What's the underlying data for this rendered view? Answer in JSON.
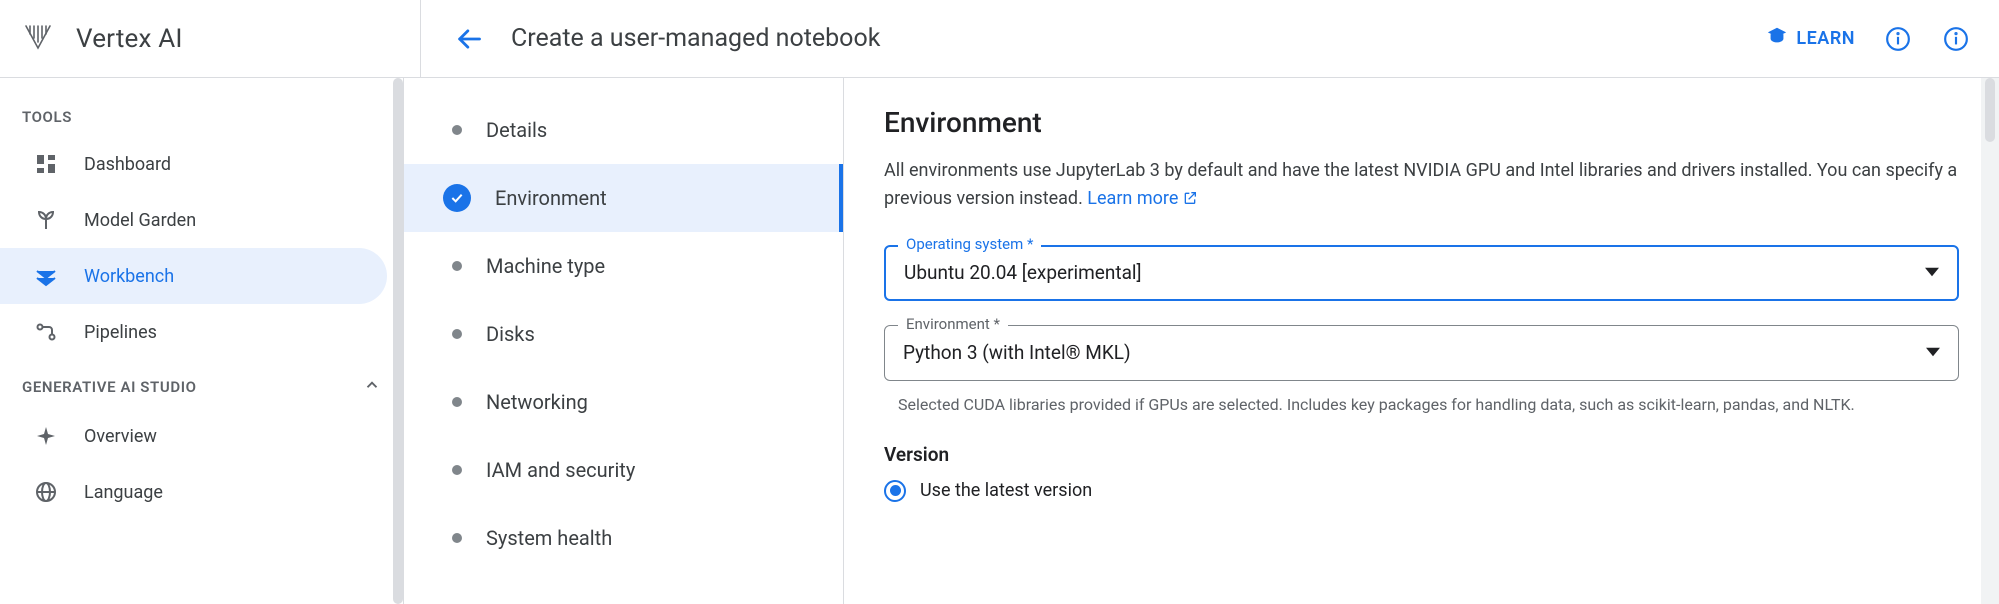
{
  "product": {
    "name": "Vertex AI"
  },
  "header": {
    "page_title": "Create a user-managed notebook",
    "learn_label": "LEARN"
  },
  "leftnav": {
    "section1_label": "TOOLS",
    "items1": [
      {
        "label": "Dashboard"
      },
      {
        "label": "Model Garden"
      },
      {
        "label": "Workbench"
      },
      {
        "label": "Pipelines"
      }
    ],
    "active1_index": 2,
    "section2_label": "GENERATIVE AI STUDIO",
    "items2": [
      {
        "label": "Overview"
      },
      {
        "label": "Language"
      }
    ]
  },
  "stepper": {
    "steps": [
      {
        "label": "Details"
      },
      {
        "label": "Environment"
      },
      {
        "label": "Machine type"
      },
      {
        "label": "Disks"
      },
      {
        "label": "Networking"
      },
      {
        "label": "IAM and security"
      },
      {
        "label": "System health"
      }
    ],
    "active_index": 1
  },
  "form": {
    "heading": "Environment",
    "description_a": "All environments use JupyterLab 3 by default and have the latest NVIDIA GPU and Intel libraries and drivers installed. You can specify a previous version instead. ",
    "learn_more": "Learn more",
    "os": {
      "label": "Operating system *",
      "value": "Ubuntu 20.04 [experimental]"
    },
    "env": {
      "label": "Environment *",
      "value": "Python 3 (with Intel® MKL)",
      "helper": "Selected CUDA libraries provided if GPUs are selected. Includes key packages for handling data, such as scikit-learn, pandas, and NLTK."
    },
    "version": {
      "heading": "Version",
      "option_latest": "Use the latest version"
    }
  }
}
